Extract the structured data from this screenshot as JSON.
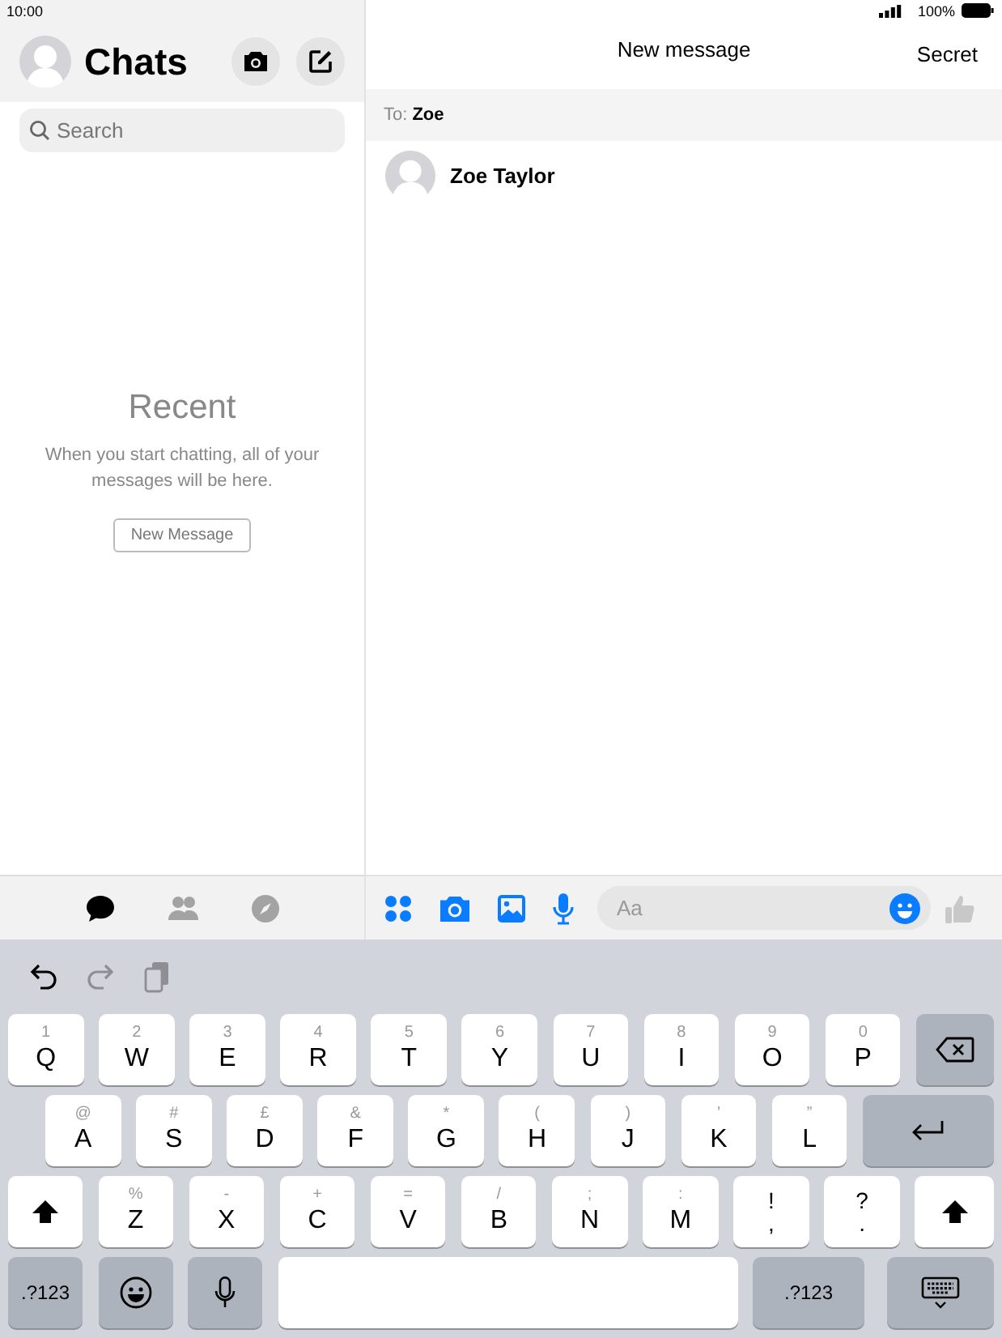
{
  "status_bar": {
    "time": "10:00",
    "battery": "100%"
  },
  "chats_panel": {
    "title": "Chats",
    "search": {
      "placeholder": "Search"
    },
    "empty_title": "Recent",
    "empty_text": "When you start chatting, all of your messages will be here.",
    "new_button": "New Message",
    "tabs": [
      {
        "kind": "chats",
        "selected": true
      },
      {
        "kind": "people",
        "selected": false
      },
      {
        "kind": "discover",
        "selected": false
      }
    ]
  },
  "message_panel": {
    "title": "New message",
    "secret": "Secret",
    "to_label": "To:",
    "to_value": "Zoe",
    "contacts": [
      {
        "name": "Zoe Taylor"
      }
    ],
    "composer": {
      "placeholder": "Aa"
    }
  },
  "keyboard": {
    "toolbar": [
      {
        "kind": "undo",
        "disabled": false
      },
      {
        "kind": "redo",
        "disabled": true
      },
      {
        "kind": "paste",
        "disabled": true
      }
    ],
    "rows": [
      [
        {
          "kind": "letter",
          "main": "Q",
          "alt": "1"
        },
        {
          "kind": "letter",
          "main": "W",
          "alt": "2"
        },
        {
          "kind": "letter",
          "main": "E",
          "alt": "3"
        },
        {
          "kind": "letter",
          "main": "R",
          "alt": "4"
        },
        {
          "kind": "letter",
          "main": "T",
          "alt": "5"
        },
        {
          "kind": "letter",
          "main": "Y",
          "alt": "6"
        },
        {
          "kind": "letter",
          "main": "U",
          "alt": "7"
        },
        {
          "kind": "letter",
          "main": "I",
          "alt": "8"
        },
        {
          "kind": "letter",
          "main": "O",
          "alt": "9"
        },
        {
          "kind": "letter",
          "main": "P",
          "alt": "0"
        },
        {
          "kind": "backspace"
        }
      ],
      [
        {
          "kind": "letter",
          "main": "A",
          "alt": "@"
        },
        {
          "kind": "letter",
          "main": "S",
          "alt": "#"
        },
        {
          "kind": "letter",
          "main": "D",
          "alt": "£"
        },
        {
          "kind": "letter",
          "main": "F",
          "alt": "&"
        },
        {
          "kind": "letter",
          "main": "G",
          "alt": "*"
        },
        {
          "kind": "letter",
          "main": "H",
          "alt": "("
        },
        {
          "kind": "letter",
          "main": "J",
          "alt": ")"
        },
        {
          "kind": "letter",
          "main": "K",
          "alt": "’"
        },
        {
          "kind": "letter",
          "main": "L",
          "alt": "”"
        },
        {
          "kind": "return"
        }
      ],
      [
        {
          "kind": "shift"
        },
        {
          "kind": "letter",
          "main": "Z",
          "alt": "%"
        },
        {
          "kind": "letter",
          "main": "X",
          "alt": "-"
        },
        {
          "kind": "letter",
          "main": "C",
          "alt": "+"
        },
        {
          "kind": "letter",
          "main": "V",
          "alt": "="
        },
        {
          "kind": "letter",
          "main": "B",
          "alt": "/"
        },
        {
          "kind": "letter",
          "main": "N",
          "alt": ";"
        },
        {
          "kind": "letter",
          "main": "M",
          "alt": ":"
        },
        {
          "kind": "punct",
          "main": ",",
          "alt": "!"
        },
        {
          "kind": "punct",
          "main": ".",
          "alt": "?"
        },
        {
          "kind": "shift"
        }
      ],
      [
        {
          "kind": "mode",
          "main": ".?123"
        },
        {
          "kind": "emoji"
        },
        {
          "kind": "mic"
        },
        {
          "kind": "space"
        },
        {
          "kind": "mode",
          "main": ".?123"
        },
        {
          "kind": "hide"
        }
      ]
    ]
  }
}
